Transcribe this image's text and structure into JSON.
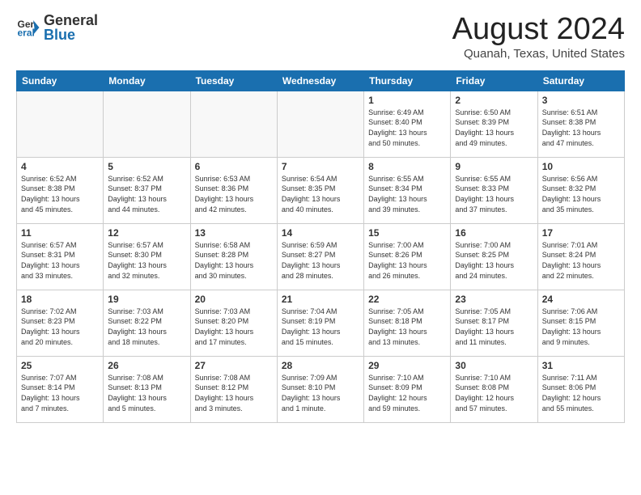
{
  "header": {
    "logo_general": "General",
    "logo_blue": "Blue",
    "month_title": "August 2024",
    "location": "Quanah, Texas, United States"
  },
  "days_of_week": [
    "Sunday",
    "Monday",
    "Tuesday",
    "Wednesday",
    "Thursday",
    "Friday",
    "Saturday"
  ],
  "weeks": [
    [
      {
        "day": "",
        "info": ""
      },
      {
        "day": "",
        "info": ""
      },
      {
        "day": "",
        "info": ""
      },
      {
        "day": "",
        "info": ""
      },
      {
        "day": "1",
        "info": "Sunrise: 6:49 AM\nSunset: 8:40 PM\nDaylight: 13 hours\nand 50 minutes."
      },
      {
        "day": "2",
        "info": "Sunrise: 6:50 AM\nSunset: 8:39 PM\nDaylight: 13 hours\nand 49 minutes."
      },
      {
        "day": "3",
        "info": "Sunrise: 6:51 AM\nSunset: 8:38 PM\nDaylight: 13 hours\nand 47 minutes."
      }
    ],
    [
      {
        "day": "4",
        "info": "Sunrise: 6:52 AM\nSunset: 8:38 PM\nDaylight: 13 hours\nand 45 minutes."
      },
      {
        "day": "5",
        "info": "Sunrise: 6:52 AM\nSunset: 8:37 PM\nDaylight: 13 hours\nand 44 minutes."
      },
      {
        "day": "6",
        "info": "Sunrise: 6:53 AM\nSunset: 8:36 PM\nDaylight: 13 hours\nand 42 minutes."
      },
      {
        "day": "7",
        "info": "Sunrise: 6:54 AM\nSunset: 8:35 PM\nDaylight: 13 hours\nand 40 minutes."
      },
      {
        "day": "8",
        "info": "Sunrise: 6:55 AM\nSunset: 8:34 PM\nDaylight: 13 hours\nand 39 minutes."
      },
      {
        "day": "9",
        "info": "Sunrise: 6:55 AM\nSunset: 8:33 PM\nDaylight: 13 hours\nand 37 minutes."
      },
      {
        "day": "10",
        "info": "Sunrise: 6:56 AM\nSunset: 8:32 PM\nDaylight: 13 hours\nand 35 minutes."
      }
    ],
    [
      {
        "day": "11",
        "info": "Sunrise: 6:57 AM\nSunset: 8:31 PM\nDaylight: 13 hours\nand 33 minutes."
      },
      {
        "day": "12",
        "info": "Sunrise: 6:57 AM\nSunset: 8:30 PM\nDaylight: 13 hours\nand 32 minutes."
      },
      {
        "day": "13",
        "info": "Sunrise: 6:58 AM\nSunset: 8:28 PM\nDaylight: 13 hours\nand 30 minutes."
      },
      {
        "day": "14",
        "info": "Sunrise: 6:59 AM\nSunset: 8:27 PM\nDaylight: 13 hours\nand 28 minutes."
      },
      {
        "day": "15",
        "info": "Sunrise: 7:00 AM\nSunset: 8:26 PM\nDaylight: 13 hours\nand 26 minutes."
      },
      {
        "day": "16",
        "info": "Sunrise: 7:00 AM\nSunset: 8:25 PM\nDaylight: 13 hours\nand 24 minutes."
      },
      {
        "day": "17",
        "info": "Sunrise: 7:01 AM\nSunset: 8:24 PM\nDaylight: 13 hours\nand 22 minutes."
      }
    ],
    [
      {
        "day": "18",
        "info": "Sunrise: 7:02 AM\nSunset: 8:23 PM\nDaylight: 13 hours\nand 20 minutes."
      },
      {
        "day": "19",
        "info": "Sunrise: 7:03 AM\nSunset: 8:22 PM\nDaylight: 13 hours\nand 18 minutes."
      },
      {
        "day": "20",
        "info": "Sunrise: 7:03 AM\nSunset: 8:20 PM\nDaylight: 13 hours\nand 17 minutes."
      },
      {
        "day": "21",
        "info": "Sunrise: 7:04 AM\nSunset: 8:19 PM\nDaylight: 13 hours\nand 15 minutes."
      },
      {
        "day": "22",
        "info": "Sunrise: 7:05 AM\nSunset: 8:18 PM\nDaylight: 13 hours\nand 13 minutes."
      },
      {
        "day": "23",
        "info": "Sunrise: 7:05 AM\nSunset: 8:17 PM\nDaylight: 13 hours\nand 11 minutes."
      },
      {
        "day": "24",
        "info": "Sunrise: 7:06 AM\nSunset: 8:15 PM\nDaylight: 13 hours\nand 9 minutes."
      }
    ],
    [
      {
        "day": "25",
        "info": "Sunrise: 7:07 AM\nSunset: 8:14 PM\nDaylight: 13 hours\nand 7 minutes."
      },
      {
        "day": "26",
        "info": "Sunrise: 7:08 AM\nSunset: 8:13 PM\nDaylight: 13 hours\nand 5 minutes."
      },
      {
        "day": "27",
        "info": "Sunrise: 7:08 AM\nSunset: 8:12 PM\nDaylight: 13 hours\nand 3 minutes."
      },
      {
        "day": "28",
        "info": "Sunrise: 7:09 AM\nSunset: 8:10 PM\nDaylight: 13 hours\nand 1 minute."
      },
      {
        "day": "29",
        "info": "Sunrise: 7:10 AM\nSunset: 8:09 PM\nDaylight: 12 hours\nand 59 minutes."
      },
      {
        "day": "30",
        "info": "Sunrise: 7:10 AM\nSunset: 8:08 PM\nDaylight: 12 hours\nand 57 minutes."
      },
      {
        "day": "31",
        "info": "Sunrise: 7:11 AM\nSunset: 8:06 PM\nDaylight: 12 hours\nand 55 minutes."
      }
    ]
  ]
}
